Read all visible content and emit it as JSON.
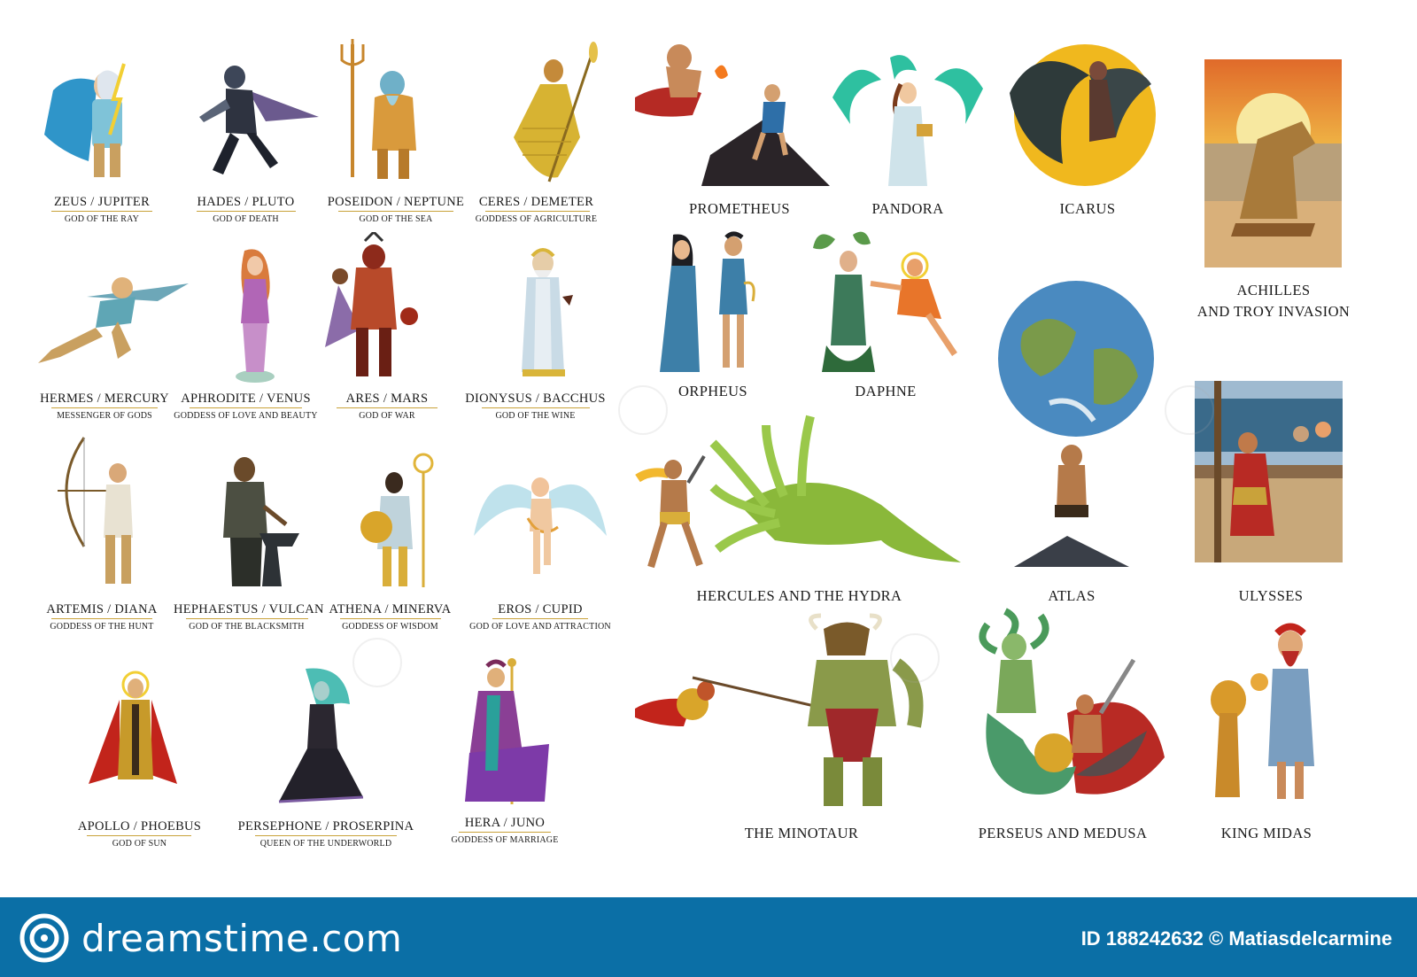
{
  "deities": [
    {
      "name": "ZEUS / JUPITER",
      "title": "GOD OF THE RAY",
      "icon": "zeus-figure-icon"
    },
    {
      "name": "HADES / PLUTO",
      "title": "GOD OF DEATH",
      "icon": "hades-figure-icon"
    },
    {
      "name": "POSEIDON / NEPTUNE",
      "title": "GOD OF THE SEA",
      "icon": "poseidon-figure-icon"
    },
    {
      "name": "CERES / DEMETER",
      "title": "GODDESS OF AGRICULTURE",
      "icon": "ceres-figure-icon"
    },
    {
      "name": "HERMES / MERCURY",
      "title": "MESSENGER OF GODS",
      "icon": "hermes-figure-icon"
    },
    {
      "name": "APHRODITE / VENUS",
      "title": "GODDESS OF LOVE AND BEAUTY",
      "icon": "aphrodite-figure-icon"
    },
    {
      "name": "ARES / MARS",
      "title": "GOD OF WAR",
      "icon": "ares-figure-icon"
    },
    {
      "name": "DIONYSUS / BACCHUS",
      "title": "GOD OF THE WINE",
      "icon": "dionysus-figure-icon"
    },
    {
      "name": "ARTEMIS / DIANA",
      "title": "GODDESS OF THE HUNT",
      "icon": "artemis-figure-icon"
    },
    {
      "name": "HEPHAESTUS / VULCAN",
      "title": "GOD OF THE BLACKSMITH",
      "icon": "hephaestus-figure-icon"
    },
    {
      "name": "ATHENA / MINERVA",
      "title": "GODDESS OF WISDOM",
      "icon": "athena-figure-icon"
    },
    {
      "name": "EROS / CUPID",
      "title": "GOD OF LOVE AND ATTRACTION",
      "icon": "eros-figure-icon"
    },
    {
      "name": "APOLLO / PHOEBUS",
      "title": "GOD OF SUN",
      "icon": "apollo-figure-icon"
    },
    {
      "name": "PERSEPHONE / PROSERPINA",
      "title": "QUEEN OF THE UNDERWORLD",
      "icon": "persephone-figure-icon"
    },
    {
      "name": "HERA / JUNO",
      "title": "GODDESS OF MARRIAGE",
      "icon": "hera-figure-icon"
    }
  ],
  "stories": [
    {
      "label": "PROMETHEUS",
      "icon": "prometheus-scene-icon"
    },
    {
      "label": "PANDORA",
      "icon": "pandora-scene-icon"
    },
    {
      "label": "ICARUS",
      "icon": "icarus-scene-icon"
    },
    {
      "label": "ACHILLES\nAND TROY INVASION",
      "icon": "trojan-horse-scene-icon"
    },
    {
      "label": "ORPHEUS",
      "icon": "orpheus-scene-icon"
    },
    {
      "label": "DAPHNE",
      "icon": "daphne-scene-icon"
    },
    {
      "label": "HERCULES AND THE HYDRA",
      "icon": "hydra-scene-icon"
    },
    {
      "label": "ATLAS",
      "icon": "atlas-globe-scene-icon"
    },
    {
      "label": "ULYSSES",
      "icon": "ulysses-ship-scene-icon"
    },
    {
      "label": "THE MINOTAUR",
      "icon": "minotaur-scene-icon"
    },
    {
      "label": "PERSEUS AND MEDUSA",
      "icon": "medusa-scene-icon"
    },
    {
      "label": "KING MIDAS",
      "icon": "midas-scene-icon"
    }
  ],
  "footer": {
    "brand": "dreamstime.com",
    "credit": "ID 188242632 © Matiasdelcarmine",
    "color": "#0b6fa6",
    "icon": "dreamstime-logo-icon"
  }
}
